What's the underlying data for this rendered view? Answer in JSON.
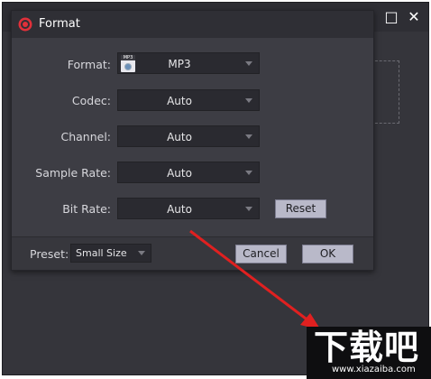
{
  "window": {
    "controls": [
      "✕",
      "□",
      "✕"
    ]
  },
  "dialog": {
    "title": "Format",
    "fields": [
      {
        "label": "Format:",
        "value": "MP3"
      },
      {
        "label": "Codec:",
        "value": "Auto"
      },
      {
        "label": "Channel:",
        "value": "Auto"
      },
      {
        "label": "Sample Rate:",
        "value": "Auto"
      },
      {
        "label": "Bit Rate:",
        "value": "Auto"
      }
    ],
    "reset_label": "Reset",
    "preset_label": "Preset:",
    "preset_value": "Small Size",
    "cancel_label": "Cancel",
    "ok_label": "OK",
    "mp3_icon_text": "MP3"
  },
  "watermark": {
    "main": "下载吧",
    "url": "www.xiazaiba.com"
  },
  "colors": {
    "accent_arrow": "#e02020",
    "logo_red": "#e0303a"
  }
}
